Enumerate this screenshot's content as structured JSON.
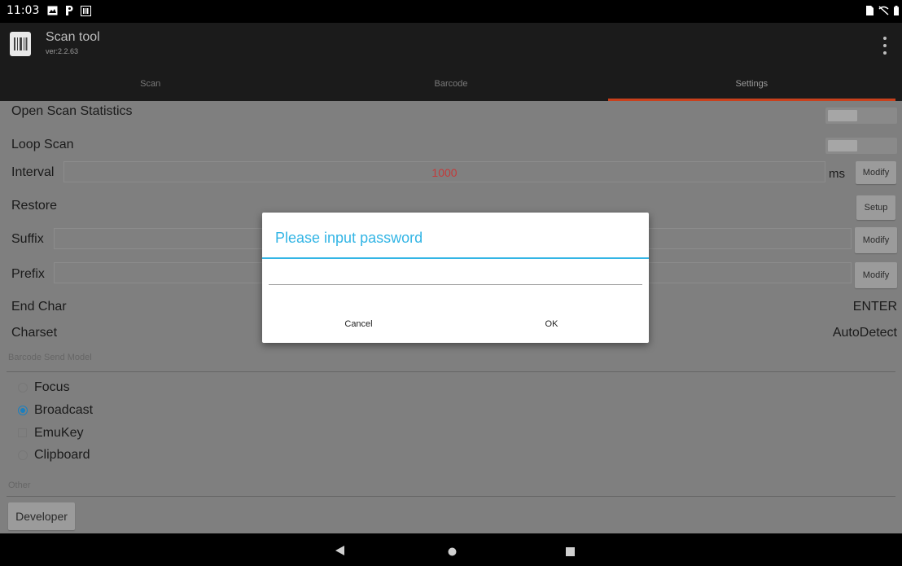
{
  "status_bar": {
    "time": "11:03"
  },
  "app": {
    "title": "Scan tool",
    "version": "ver:2.2.63"
  },
  "tabs": [
    {
      "label": "Scan"
    },
    {
      "label": "Barcode"
    },
    {
      "label": "Settings"
    }
  ],
  "settings": {
    "open_scan_statistics": {
      "label": "Open Scan Statistics",
      "toggle_state": "off"
    },
    "loop_scan": {
      "label": "Loop Scan",
      "toggle_state": "off"
    },
    "interval": {
      "label": "Interval",
      "value": "1000",
      "unit": "ms",
      "button": "Modify"
    },
    "restore": {
      "label": "Restore",
      "button": "Setup"
    },
    "suffix": {
      "label": "Suffix",
      "value": "",
      "button": "Modify"
    },
    "prefix": {
      "label": "Prefix",
      "value": "",
      "button": "Modify"
    },
    "end_char": {
      "label": "End Char",
      "value": "ENTER"
    },
    "charset": {
      "label": "Charset",
      "value": "AutoDetect"
    }
  },
  "send_model": {
    "section_label": "Barcode Send Model",
    "options": [
      {
        "label": "Focus",
        "type": "radio",
        "checked": false
      },
      {
        "label": "Broadcast",
        "type": "radio",
        "checked": true
      },
      {
        "label": "EmuKey",
        "type": "checkbox",
        "checked": false
      },
      {
        "label": "Clipboard",
        "type": "radio",
        "checked": false
      }
    ]
  },
  "other": {
    "section_label": "Other",
    "developer_button": "Developer"
  },
  "dialog": {
    "title": "Please input password",
    "input_value": "",
    "cancel": "Cancel",
    "ok": "OK"
  },
  "nav_bar": {
    "back": "back",
    "home": "home",
    "recents": "recents"
  },
  "colors": {
    "accent": "#33b5e5",
    "tab_indicator": "#c9401c",
    "interval_value": "#c23b3b",
    "radio_selected": "#1a7fbf",
    "overlay": "#7f7f7f"
  }
}
